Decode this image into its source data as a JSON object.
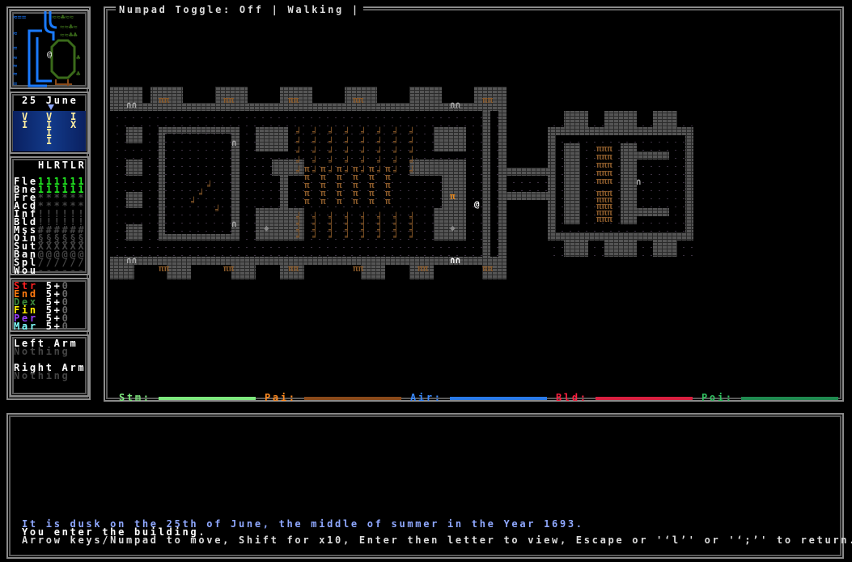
{
  "top_bar": {
    "numpad": "Numpad Toggle: Off",
    "mode": "Walking",
    "sep": "|"
  },
  "date": {
    "day": "25",
    "month": "June",
    "calendar": [
      "V",
      "V",
      "I",
      "I",
      "I",
      "X",
      "I",
      "I",
      "I"
    ]
  },
  "wounds": {
    "header": "HLRTLR",
    "rows": [
      {
        "label": "Fle",
        "values": "111111",
        "color": "#22ee22"
      },
      {
        "label": "Bne",
        "values": "111111",
        "color": "#22ee22"
      },
      {
        "label": "Fre",
        "values": "******",
        "color": "#444"
      },
      {
        "label": "Acd",
        "values": "******",
        "color": "#444"
      },
      {
        "label": "Inf",
        "values": "!!!!!!",
        "color": "#444"
      },
      {
        "label": "Bld",
        "values": "!!!!!!",
        "color": "#444"
      },
      {
        "label": "Mss",
        "values": "######",
        "color": "#444"
      },
      {
        "label": "Oin",
        "values": "§§§§§§",
        "color": "#444"
      },
      {
        "label": "Sut",
        "values": "XXXXXX",
        "color": "#444"
      },
      {
        "label": "Ban",
        "values": "@@@@@@",
        "color": "#444"
      },
      {
        "label": "Spl",
        "values": "//////",
        "color": "#444"
      },
      {
        "label": "Wou",
        "values": "------",
        "color": "#444"
      }
    ]
  },
  "stats": [
    {
      "label": "Str",
      "value": "5+",
      "bonus": "0",
      "color": "#ff2020"
    },
    {
      "label": "End",
      "value": "5+",
      "bonus": "0",
      "color": "#ff7a10"
    },
    {
      "label": "Dex",
      "value": "5+",
      "bonus": "0",
      "color": "#3c8a3c"
    },
    {
      "label": "Fin",
      "value": "5+",
      "bonus": "0",
      "color": "#ffee00"
    },
    {
      "label": "Per",
      "value": "5+",
      "bonus": "0",
      "color": "#9a40ff"
    },
    {
      "label": "Mar",
      "value": "5+",
      "bonus": "0",
      "color": "#80ffff"
    }
  ],
  "arms": {
    "left_label": "Left Arm",
    "left_value": "Nothing",
    "right_label": "Right Arm",
    "right_value": "Nothing"
  },
  "meters": [
    {
      "label": "Stm:",
      "color": "#7ee87e",
      "fill": 1.0
    },
    {
      "label": "Pai:",
      "color": "#8a4a1a",
      "fill": 1.0
    },
    {
      "label": "Air:",
      "color": "#2a7ae8",
      "fill": 1.0
    },
    {
      "label": "Bld:",
      "color": "#d82040",
      "fill": 1.0
    },
    {
      "label": "Poi:",
      "color": "#208a50",
      "fill": 1.0
    }
  ],
  "label_colors": {
    "Stm:": "#7ee87e",
    "Pai:": "#ff8a20",
    "Air:": "#3a8aff",
    "Bld:": "#ff2040",
    "Poi:": "#30c060"
  },
  "messages": [
    {
      "text": "It is dusk on the 25th of June, the middle of summer in the Year 1693.",
      "color": "#8fa8ff"
    },
    {
      "text": "You enter the building.",
      "color": "#ffffff"
    },
    {
      "text": "Arrow keys/Numpad to move, Shift for x10, Enter then letter to view, Escape or 'ʻlʼ' or 'ʻ;ʼ' to return.",
      "color": "#dddddd"
    }
  ],
  "map": {
    "player": "@"
  }
}
